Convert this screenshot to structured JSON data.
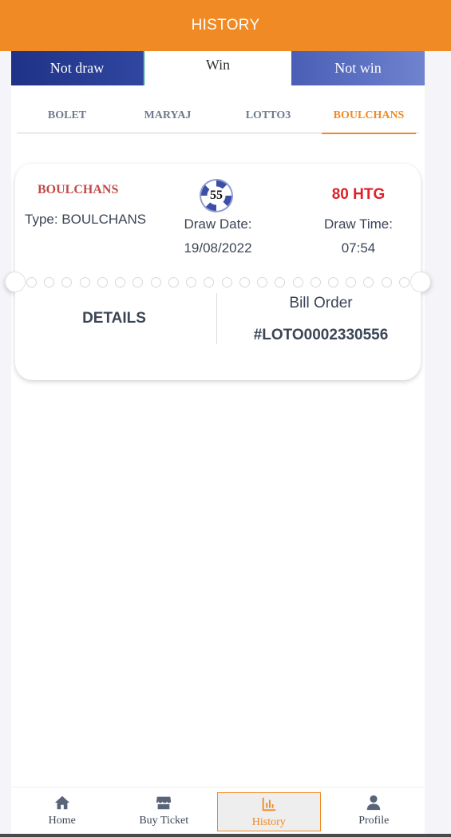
{
  "header": {
    "title": "HISTORY"
  },
  "status_tabs": [
    {
      "label": "Not draw"
    },
    {
      "label": "Win"
    },
    {
      "label": "Not win"
    }
  ],
  "game_tabs": [
    {
      "label": "BOLET"
    },
    {
      "label": "MARYAJ"
    },
    {
      "label": "LOTTO3"
    },
    {
      "label": "BOULCHANS"
    }
  ],
  "game_tabs_selected": "BOULCHANS",
  "ticket": {
    "game": "BOULCHANS",
    "type": "Type: BOULCHANS",
    "number": "55",
    "draw_date_label": "Draw Date:",
    "draw_date": "19/08/2022",
    "amount": "80 HTG",
    "draw_time_label": "Draw Time:",
    "draw_time": "07:54",
    "details_label": "DETAILS",
    "bill_order_label": "Bill Order",
    "bill_order_number": "#LOTO0002330556"
  },
  "bottom_nav": [
    {
      "label": "Home",
      "icon": "home-icon"
    },
    {
      "label": "Buy Ticket",
      "icon": "store-icon"
    },
    {
      "label": "History",
      "icon": "chart-icon"
    },
    {
      "label": "Profile",
      "icon": "user-icon"
    }
  ],
  "bottom_nav_selected": "History",
  "colors": {
    "accent": "#f08a24",
    "not_draw": "#1f3286",
    "not_win": "#5b6fc2",
    "amount": "#e0202a",
    "game_label": "#c24a4a"
  }
}
